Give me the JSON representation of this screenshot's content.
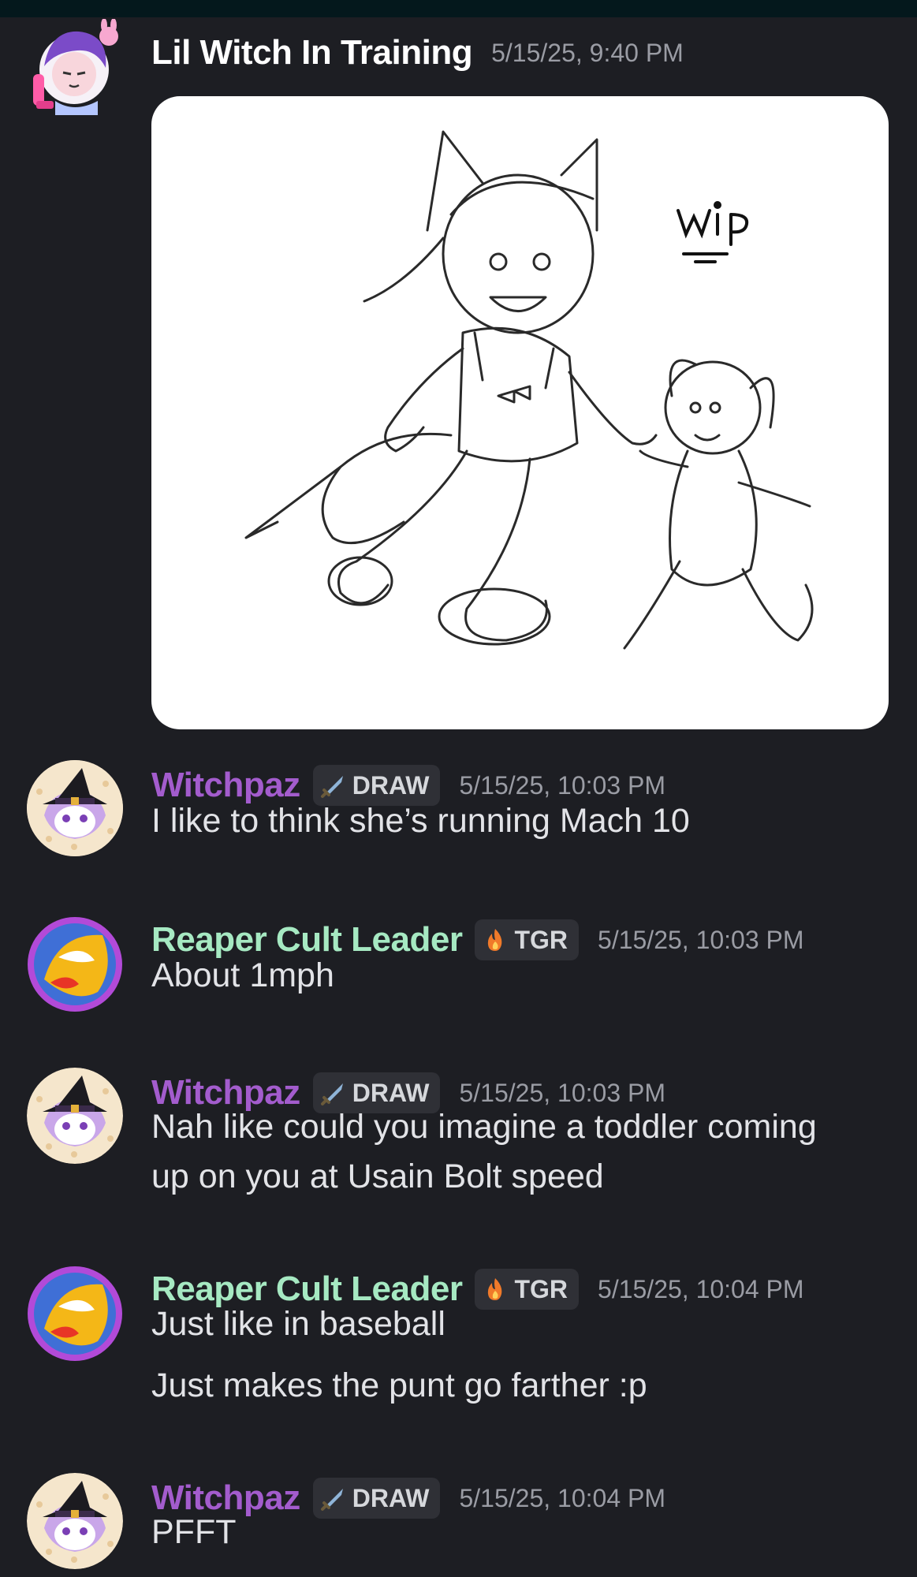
{
  "messages": [
    {
      "author": "Lil Witch In Training",
      "timestamp": "5/15/25, 9:40 PM",
      "attachment": {
        "type": "image",
        "caption_text": "wip"
      }
    },
    {
      "author": "Witchpaz",
      "tag": "DRAW",
      "timestamp": "5/15/25, 10:03 PM",
      "lines": [
        "I like to think she’s running Mach 10"
      ]
    },
    {
      "author": "Reaper Cult Leader",
      "tag": "TGR",
      "timestamp": "5/15/25, 10:03 PM",
      "lines": [
        "About 1mph"
      ]
    },
    {
      "author": "Witchpaz",
      "tag": "DRAW",
      "timestamp": "5/15/25, 10:03 PM",
      "lines": [
        "Nah like could you imagine a toddler coming",
        "up on you at Usain Bolt speed"
      ]
    },
    {
      "author": "Reaper Cult Leader",
      "tag": "TGR",
      "timestamp": "5/15/25, 10:04 PM",
      "lines": [
        "Just like in baseball",
        "Just makes the punt go farther :p"
      ]
    },
    {
      "author": "Witchpaz",
      "tag": "DRAW",
      "timestamp": "5/15/25, 10:04 PM",
      "lines": [
        "PFFT"
      ]
    }
  ],
  "icons": {
    "draw_tag": "sword-icon",
    "tgr_tag": "fire-icon"
  },
  "colors": {
    "background": "#1d1e23",
    "witchpaz_name": "#a35ccd",
    "reaper_name": "#a6e9c2",
    "tag_bg": "#2f3036"
  }
}
